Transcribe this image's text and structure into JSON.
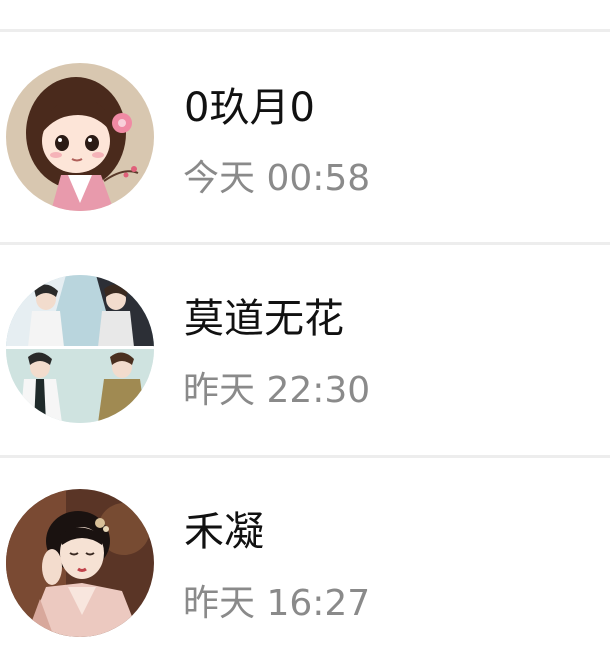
{
  "contacts": [
    {
      "name": "0玖月0",
      "time": "今天 00:58",
      "avatar_icon": "cartoon-girl-avatar"
    },
    {
      "name": "莫道无花",
      "time": "昨天 22:30",
      "avatar_icon": "anime-collage-avatar"
    },
    {
      "name": "禾凝",
      "time": "昨天 16:27",
      "avatar_icon": "hanfu-portrait-avatar"
    }
  ],
  "colors": {
    "background": "#ffffff",
    "divider": "#ededed",
    "name_text": "#111111",
    "time_text": "#8a8a8a"
  }
}
